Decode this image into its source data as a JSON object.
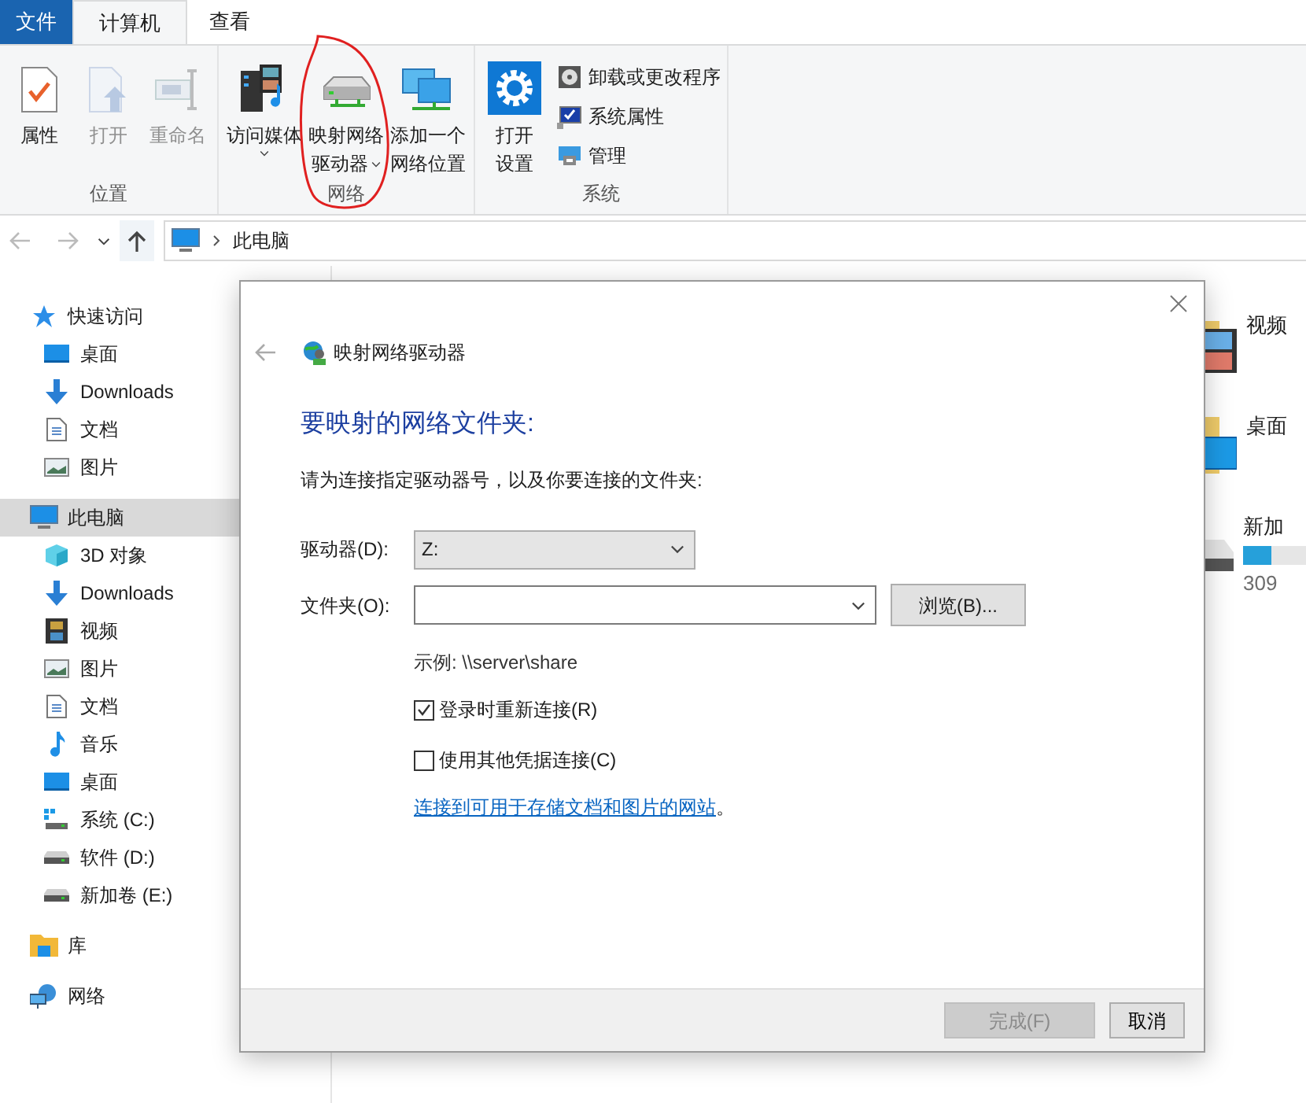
{
  "ribbon_tabs": [
    {
      "label": "文件",
      "kind": "file",
      "selected": false
    },
    {
      "label": "计算机",
      "kind": "tab",
      "selected": true
    },
    {
      "label": "查看",
      "kind": "tab",
      "selected": false
    }
  ],
  "ribbon_groups": [
    {
      "label": "位置",
      "buttons": [
        {
          "lines": [
            "属性"
          ],
          "kind": "properties",
          "disabled": false,
          "dropdown": false
        },
        {
          "lines": [
            "打开"
          ],
          "kind": "open",
          "disabled": true,
          "dropdown": false
        },
        {
          "lines": [
            "重命名"
          ],
          "kind": "rename",
          "disabled": true,
          "dropdown": false
        }
      ]
    },
    {
      "label": "网络",
      "buttons": [
        {
          "lines": [
            "访问媒体"
          ],
          "kind": "media",
          "disabled": false,
          "dropdown": true
        },
        {
          "lines": [
            "映射网络",
            "驱动器"
          ],
          "kind": "drive",
          "disabled": false,
          "dropdown": true
        },
        {
          "lines": [
            "添加一个",
            "网络位置"
          ],
          "kind": "monitors",
          "disabled": false,
          "dropdown": false
        }
      ]
    },
    {
      "label": "系统",
      "buttons": [
        {
          "lines": [
            "打开",
            "设置"
          ],
          "kind": "gear",
          "disabled": false,
          "dropdown": false
        }
      ],
      "small_buttons": [
        {
          "label": "卸载或更改程序",
          "kind": "disc"
        },
        {
          "label": "系统属性",
          "kind": "sysprops"
        },
        {
          "label": "管理",
          "kind": "manage"
        }
      ]
    }
  ],
  "address_bar": {
    "path": "此电脑"
  },
  "sidebar": {
    "items": [
      {
        "label": "快速访问",
        "kind": "star",
        "selected": false,
        "children": [
          {
            "label": "桌面",
            "kind": "desktop",
            "selected": false
          },
          {
            "label": "Downloads",
            "kind": "download",
            "selected": false
          },
          {
            "label": "文档",
            "kind": "document",
            "selected": false
          },
          {
            "label": "图片",
            "kind": "pictures",
            "selected": false
          }
        ]
      },
      {
        "label": "此电脑",
        "kind": "pc",
        "selected": true,
        "children": [
          {
            "label": "3D 对象",
            "kind": "cube",
            "selected": false
          },
          {
            "label": "Downloads",
            "kind": "download",
            "selected": false
          },
          {
            "label": "视频",
            "kind": "video",
            "selected": false
          },
          {
            "label": "图片",
            "kind": "pictures",
            "selected": false
          },
          {
            "label": "文档",
            "kind": "document",
            "selected": false
          },
          {
            "label": "音乐",
            "kind": "music",
            "selected": false
          },
          {
            "label": "桌面",
            "kind": "desktop",
            "selected": false
          },
          {
            "label": "系统 (C:)",
            "kind": "sysdrive",
            "selected": false
          },
          {
            "label": "软件 (D:)",
            "kind": "hdd",
            "selected": false
          },
          {
            "label": "新加卷 (E:)",
            "kind": "hdd",
            "selected": false
          }
        ]
      },
      {
        "label": "库",
        "kind": "library",
        "selected": false
      },
      {
        "label": "网络",
        "kind": "network",
        "selected": false
      }
    ]
  },
  "content_items": [
    {
      "label": "视频",
      "kind": "video-folder"
    },
    {
      "label": "桌面",
      "kind": "desktop-folder"
    },
    {
      "label": "新加",
      "kind": "drive",
      "usage": "309",
      "level": 0.45
    }
  ],
  "dialog": {
    "title": "映射网络驱动器",
    "heading": "要映射的网络文件夹:",
    "instruction": "请为连接指定驱动器号，以及你要连接的文件夹:",
    "drive": {
      "label": "驱动器(D):",
      "value": "Z:"
    },
    "folder": {
      "label": "文件夹(O):",
      "browse": "浏览(B)..."
    },
    "example": "示例: \\\\server\\share",
    "checkboxes": [
      {
        "label": "登录时重新连接(R)",
        "checked": true
      },
      {
        "label": "使用其他凭据连接(C)",
        "checked": false
      }
    ],
    "link": "连接到可用于存储文档和图片的网站",
    "link_suffix": "。",
    "buttons": [
      {
        "label": "完成(F)",
        "disabled": true
      },
      {
        "label": "取消",
        "disabled": false
      }
    ]
  }
}
